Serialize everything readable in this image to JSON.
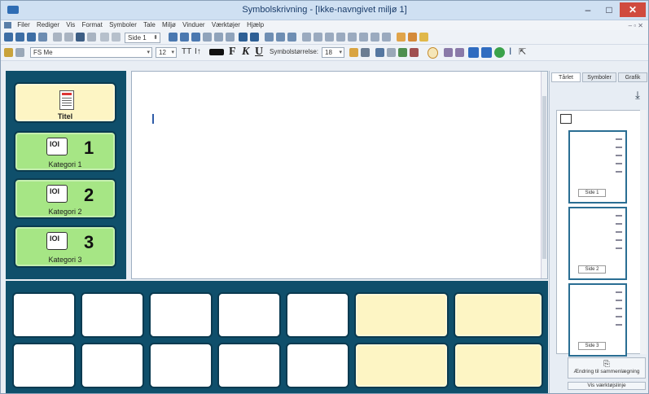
{
  "window": {
    "title": "Symbolskrivning - [Ikke-navngivet miljø 1]"
  },
  "menu": [
    "Filer",
    "Rediger",
    "Vis",
    "Format",
    "Symboler",
    "Tale",
    "Miljø",
    "Vinduer",
    "Værktøjer",
    "Hjælp"
  ],
  "toolbar": {
    "page_combo": "Side 1"
  },
  "format_bar": {
    "font_name": "FS Me",
    "font_size": "12",
    "bold": "F",
    "italic": "K",
    "underline": "U",
    "symbol_size_label": "Symbolstørrelse:",
    "symbol_size": "18"
  },
  "left_buttons": [
    {
      "label": "Titel",
      "number": ""
    },
    {
      "label": "Kategori 1",
      "number": "1"
    },
    {
      "label": "Kategori 2",
      "number": "2"
    },
    {
      "label": "Kategori 3",
      "number": "3"
    }
  ],
  "right_panel": {
    "tabs": [
      "Tårlet",
      "Symboler",
      "Grafik"
    ],
    "pages": [
      "Side 1",
      "Side 2",
      "Side 3"
    ],
    "add_button": "Ændring til sammenlægning",
    "show_button": "Vis værktøjslinje"
  },
  "colors": {
    "panel": "#0f4f6b",
    "green_button": "#a6e685",
    "yellow_button": "#fdf5c4",
    "accent": "#2a6e93"
  }
}
